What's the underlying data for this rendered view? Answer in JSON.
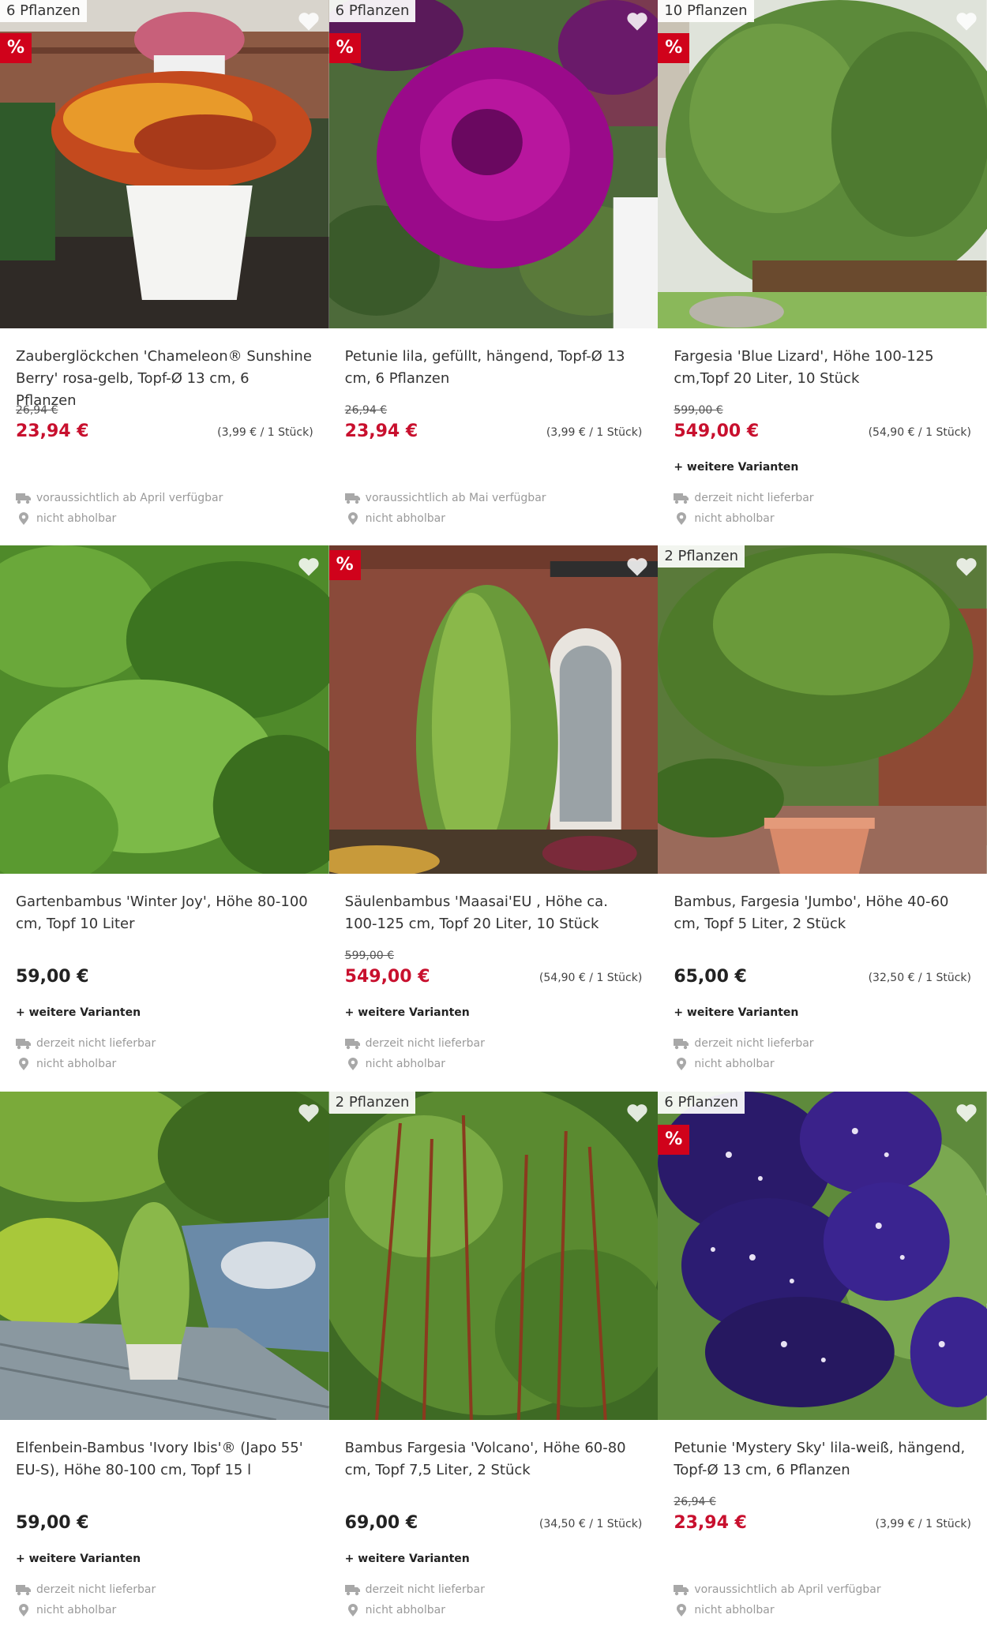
{
  "colors": {
    "sale_red": "#d0021b",
    "price_red": "#c8102e",
    "muted": "#9a9a9a"
  },
  "products": [
    {
      "count_badge": "6 Pflanzen",
      "sale": true,
      "sale_label": "%",
      "image": "orange-yellow calibrachoa flowers in white pot on wooden terrace",
      "title": "Zauberglöckchen 'Chameleon® Sunshine Berry' rosa-gelb, Topf-Ø 13 cm, 6 Pflanzen",
      "old_price": "26,94 €",
      "price": "23,94 €",
      "unit_price": "(3,99 € / 1 Stück)",
      "variants": "",
      "availability": "voraussichtlich ab April verfügbar",
      "pickup": "nicht abholbar"
    },
    {
      "count_badge": "6 Pflanzen",
      "sale": true,
      "sale_label": "%",
      "image": "magenta double petunia flower close-up",
      "title": "Petunie lila, gefüllt, hängend, Topf-Ø 13 cm, 6 Pflanzen",
      "old_price": "26,94 €",
      "price": "23,94 €",
      "unit_price": "(3,99 € / 1 Stück)",
      "variants": "",
      "availability": "voraussichtlich ab Mai verfügbar",
      "pickup": "nicht abholbar"
    },
    {
      "count_badge": "10 Pflanzen",
      "sale": true,
      "sale_label": "%",
      "image": "bamboo hedge along wicker fence",
      "title": "Fargesia 'Blue Lizard', Höhe 100-125 cm,Topf 20 Liter, 10 Stück",
      "old_price": "599,00 €",
      "price": "549,00 €",
      "unit_price": "(54,90 € / 1 Stück)",
      "variants": "+ weitere Varianten",
      "availability": "derzeit nicht lieferbar",
      "pickup": "nicht abholbar"
    },
    {
      "count_badge": "",
      "sale": false,
      "sale_label": "",
      "image": "dense green bamboo leaves",
      "title": "Gartenbambus 'Winter Joy', Höhe 80-100 cm, Topf 10 Liter",
      "old_price": "",
      "price": "59,00 €",
      "unit_price": "",
      "variants": "+ weitere Varianten",
      "availability": "derzeit nicht lieferbar",
      "pickup": "nicht abholbar"
    },
    {
      "count_badge": "",
      "sale": true,
      "sale_label": "%",
      "image": "column bamboo in front of brick wall with arched window",
      "title": "Säulenbambus 'Maasai'EU  , Höhe ca. 100-125 cm, Topf 20 Liter, 10 Stück",
      "old_price": "599,00 €",
      "price": "549,00 €",
      "unit_price": "(54,90 € / 1 Stück)",
      "variants": "+ weitere Varianten",
      "availability": "derzeit nicht lieferbar",
      "pickup": "nicht abholbar"
    },
    {
      "count_badge": "2 Pflanzen",
      "sale": false,
      "sale_label": "",
      "image": "bamboo in terracotta pot beside brick wall",
      "title": "Bambus, Fargesia 'Jumbo', Höhe 40-60 cm, Topf 5 Liter, 2 Stück",
      "old_price": "",
      "price": "65,00 €",
      "unit_price": "(32,50 € / 1 Stück)",
      "variants": "+ weitere Varianten",
      "availability": "derzeit nicht lieferbar",
      "pickup": "nicht abholbar"
    },
    {
      "count_badge": "",
      "sale": false,
      "sale_label": "",
      "image": "potted bamboo on wooden deck by pond",
      "title": "Elfenbein-Bambus 'Ivory Ibis'® (Japo 55' EU-S), Höhe 80-100 cm, Topf 15 l",
      "old_price": "",
      "price": "59,00 €",
      "unit_price": "",
      "variants": "+ weitere Varianten",
      "availability": "derzeit nicht lieferbar",
      "pickup": "nicht abholbar"
    },
    {
      "count_badge": "2 Pflanzen",
      "sale": false,
      "sale_label": "",
      "image": "red-stemmed bamboo canes with green leaves",
      "title": "Bambus Fargesia 'Volcano', Höhe 60-80 cm, Topf 7,5 Liter, 2 Stück",
      "old_price": "",
      "price": "69,00 €",
      "unit_price": "(34,50 € / 1 Stück)",
      "variants": "+ weitere Varianten",
      "availability": "derzeit nicht lieferbar",
      "pickup": "nicht abholbar"
    },
    {
      "count_badge": "6 Pflanzen",
      "sale": true,
      "sale_label": "%",
      "image": "dark purple petunias with white speckles",
      "title": "Petunie 'Mystery Sky' lila-weiß, hängend, Topf-Ø 13 cm, 6 Pflanzen",
      "old_price": "26,94 €",
      "price": "23,94 €",
      "unit_price": "(3,99 € / 1 Stück)",
      "variants": "",
      "availability": "voraussichtlich ab April verfügbar",
      "pickup": "nicht abholbar"
    }
  ]
}
